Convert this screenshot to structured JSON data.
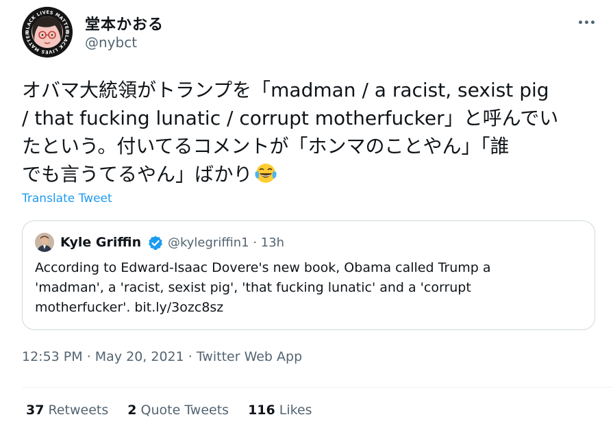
{
  "author": {
    "display_name": "堂本かおる",
    "handle": "@nybct",
    "avatar_ring_text": "BLACK LIVES MATTER"
  },
  "tweet": {
    "text_lines": [
      "オバマ大統領がトランプを「madman / a racist, sexist pig",
      "/ that fucking lunatic / corrupt motherfucker」と呼んでい",
      "たという。付いてるコメントが「ホンマのことやん」「誰",
      "でも言うてるやん」ばかり"
    ],
    "emoji": "face-with-tears-of-joy",
    "translate_label": "Translate Tweet"
  },
  "quote": {
    "name": "Kyle Griffin",
    "handle": "@kylegriffin1 · 13h",
    "text_lines": [
      "According to Edward-Isaac Dovere's new book, Obama called Trump a",
      "'madman', a 'racist, sexist pig', 'that fucking lunatic' and a 'corrupt",
      "motherfucker'. bit.ly/3ozc8sz"
    ]
  },
  "meta": {
    "time": "12:53 PM",
    "separator": " · ",
    "date": "May 20, 2021",
    "source": "Twitter Web App"
  },
  "stats": {
    "retweets_count": "37",
    "retweets_label": "Retweets",
    "quotes_count": "2",
    "quotes_label": "Quote Tweets",
    "likes_count": "116",
    "likes_label": "Likes"
  },
  "colors": {
    "text": "#0f1419",
    "secondary": "#536471",
    "link": "#1d9bf0",
    "border": "#cfd9de"
  }
}
